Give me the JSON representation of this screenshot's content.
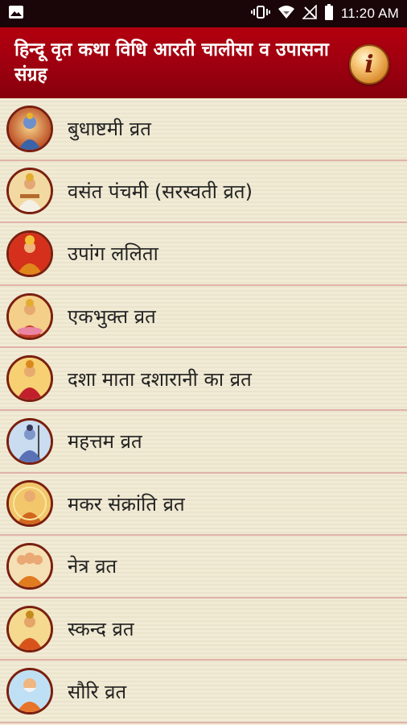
{
  "status_bar": {
    "time": "11:20 AM",
    "icons": [
      "image-icon",
      "vibrate-icon",
      "wifi-icon",
      "no-signal-icon",
      "battery-icon"
    ]
  },
  "app_bar": {
    "title": "हिन्दू वृत कथा विधि आरती चालीसा व उपासना संग्रह",
    "info_icon_glyph": "i"
  },
  "items": [
    {
      "label": "बुधाष्टमी व्रत"
    },
    {
      "label": "वसंत पंचमी (सरस्वती व्रत)"
    },
    {
      "label": "उपांग ललिता"
    },
    {
      "label": "एकभुक्त व्रत"
    },
    {
      "label": "दशा माता दशारानी का व्रत"
    },
    {
      "label": "महत्तम व्रत"
    },
    {
      "label": "मकर संक्रांति व्रत"
    },
    {
      "label": "नेत्र व्रत"
    },
    {
      "label": "स्कन्द व्रत"
    },
    {
      "label": "सौरि व्रत"
    }
  ],
  "colors": {
    "app_bar": "#a0000f",
    "status_bar": "#1a0509",
    "list_bg": "#efe9d3",
    "divider": "#e0b2a9"
  }
}
